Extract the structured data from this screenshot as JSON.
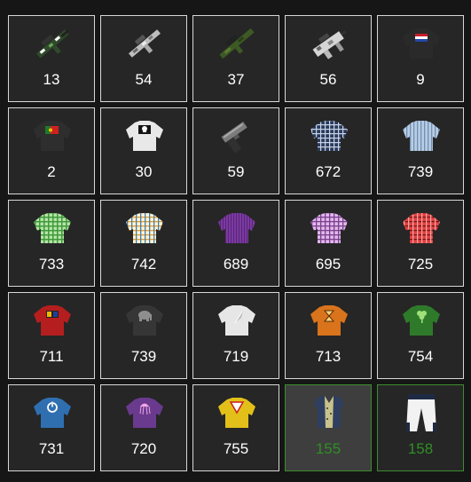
{
  "inventory": {
    "items": [
      {
        "name": "camo-rifle-icon",
        "qty": "13"
      },
      {
        "name": "white-camo-rifle-icon",
        "qty": "54"
      },
      {
        "name": "green-sniper-rifle-icon",
        "qty": "37"
      },
      {
        "name": "white-smg-icon",
        "qty": "56"
      },
      {
        "name": "dutch-flag-shirt-icon",
        "qty": "9"
      },
      {
        "name": "portugal-flag-shirt-icon",
        "qty": "2"
      },
      {
        "name": "skull-white-shirt-icon",
        "qty": "30"
      },
      {
        "name": "pistol-icon",
        "qty": "59"
      },
      {
        "name": "navy-plaid-shirt-icon",
        "qty": "672"
      },
      {
        "name": "blue-striped-shirt-icon",
        "qty": "739"
      },
      {
        "name": "green-plaid-shirt-icon",
        "qty": "733"
      },
      {
        "name": "orange-plaid-shirt-icon",
        "qty": "742"
      },
      {
        "name": "purple-striped-shirt-icon",
        "qty": "689"
      },
      {
        "name": "lavender-plaid-shirt-icon",
        "qty": "695"
      },
      {
        "name": "red-plaid-shirt-icon",
        "qty": "725"
      },
      {
        "name": "red-crest-shirt-icon",
        "qty": "711"
      },
      {
        "name": "elephant-shirt-icon",
        "qty": "739"
      },
      {
        "name": "white-feather-shirt-icon",
        "qty": "719"
      },
      {
        "name": "hourglass-shirt-icon",
        "qty": "713"
      },
      {
        "name": "clover-shirt-icon",
        "qty": "754"
      },
      {
        "name": "power-symbol-shirt-icon",
        "qty": "731"
      },
      {
        "name": "jellyfish-shirt-icon",
        "qty": "720"
      },
      {
        "name": "yellow-triangle-shirt-icon",
        "qty": "755"
      },
      {
        "name": "navy-vest-icon",
        "qty": "155"
      },
      {
        "name": "white-pants-icon",
        "qty": "158"
      }
    ]
  },
  "colors": {
    "tile_border": "#d8d8d8",
    "equipped_border": "#3d8c2f",
    "equipped_text": "#2f8f24",
    "tile_bg": "#262626"
  }
}
